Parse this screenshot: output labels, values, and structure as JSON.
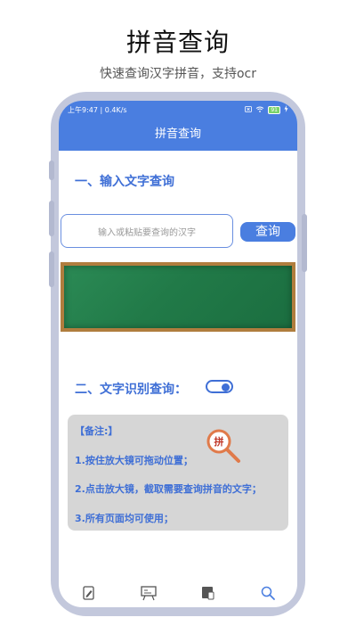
{
  "promo": {
    "title": "拼音查询",
    "subtitle": "快速查询汉字拼音，支持ocr"
  },
  "statusbar": {
    "left": "上午9:47 | 0.4K/s",
    "right_icons": [
      "sim-icon",
      "wifi-icon",
      "battery-icon",
      "charging-icon"
    ],
    "battery": "91"
  },
  "app": {
    "title": "拼音查询",
    "accent": "#4a7ee0"
  },
  "section1": {
    "label": "一、输入文字查询",
    "input_placeholder": "输入或粘贴要查询的汉字",
    "query_button": "查询"
  },
  "section2": {
    "label": "二、文字识别查询：",
    "toggle_on": true
  },
  "notes": {
    "heading": "【备注:】",
    "items": [
      "1.按住放大镜可拖动位置；",
      "2.点击放大镜，截取需要查询拼音的文字；",
      "3.所有页面均可使用；"
    ],
    "magnifier_text": "拼"
  },
  "bottom_nav": [
    "edit-icon",
    "board-icon",
    "book-icon",
    "search-icon"
  ]
}
